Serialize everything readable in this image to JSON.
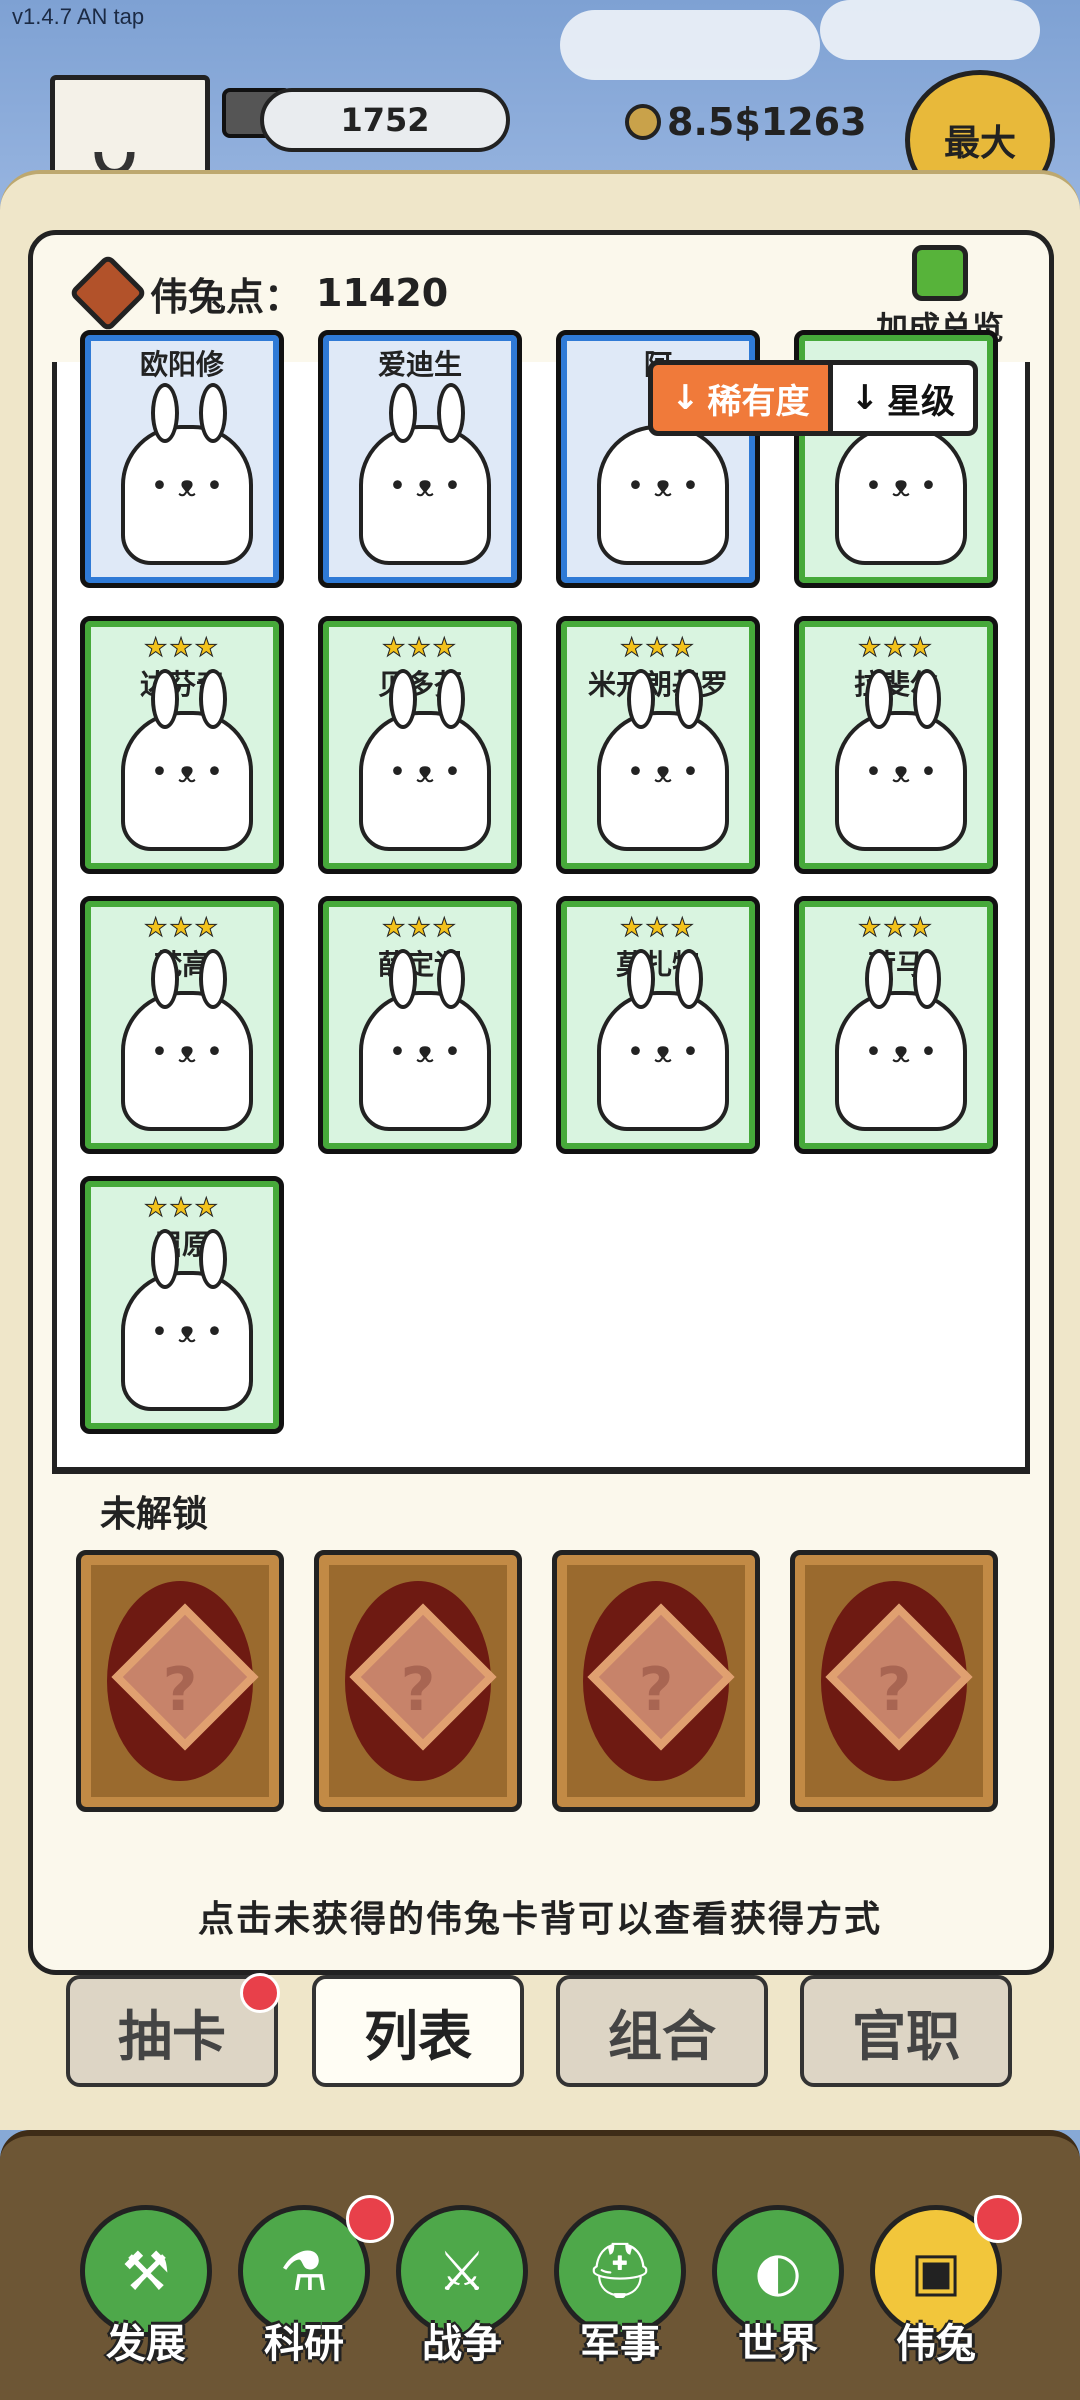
{
  "app": {
    "version": "v1.4.7 AN tap"
  },
  "top": {
    "resource_amount": "1752",
    "money": "8.5$1263",
    "max_button": "最大"
  },
  "panel": {
    "points_label": "伟兔点：",
    "points_value": "11420",
    "bonus_label": "加成总览",
    "sort": {
      "rarity": "稀有度",
      "stars": "星级"
    },
    "cards": [
      {
        "name": "欧阳修",
        "stars": "",
        "color": "blue"
      },
      {
        "name": "爱迪生",
        "stars": "",
        "color": "blue"
      },
      {
        "name": "阿",
        "stars": "",
        "color": "blue"
      },
      {
        "name": "",
        "stars": "",
        "color": "green"
      },
      {
        "name": "达芬奇",
        "stars": "★★★",
        "color": "green"
      },
      {
        "name": "贝多芬",
        "stars": "★★★",
        "color": "green"
      },
      {
        "name": "米开朗基罗",
        "stars": "★★★",
        "color": "green"
      },
      {
        "name": "拉斐尔",
        "stars": "★★★",
        "color": "green"
      },
      {
        "name": "梵高",
        "stars": "★★★",
        "color": "green"
      },
      {
        "name": "薛定谔",
        "stars": "★★★",
        "color": "green"
      },
      {
        "name": "莫扎特",
        "stars": "★★★",
        "color": "green"
      },
      {
        "name": "荷马",
        "stars": "★★★",
        "color": "green"
      },
      {
        "name": "屈原",
        "stars": "★★★",
        "color": "green"
      }
    ],
    "locked_label": "未解锁",
    "locked_count": 4,
    "hint": "点击未获得的伟兔卡背可以查看获得方式"
  },
  "tabs": [
    {
      "label": "抽卡",
      "badge": true
    },
    {
      "label": "列表",
      "active": true
    },
    {
      "label": "组合"
    },
    {
      "label": "官职"
    }
  ],
  "nav": [
    {
      "label": "发展",
      "icon": "hammer-icon"
    },
    {
      "label": "科研",
      "icon": "flask-icon",
      "badge": true
    },
    {
      "label": "战争",
      "icon": "swords-icon"
    },
    {
      "label": "军事",
      "icon": "helmet-icon"
    },
    {
      "label": "世界",
      "icon": "globe-icon"
    },
    {
      "label": "伟兔",
      "icon": "card-icon",
      "badge": true,
      "active": true
    }
  ],
  "colors": {
    "accent": "#f07a3a",
    "green": "#46a93a",
    "blue": "#2f7ad6",
    "badge": "#e8404a"
  }
}
